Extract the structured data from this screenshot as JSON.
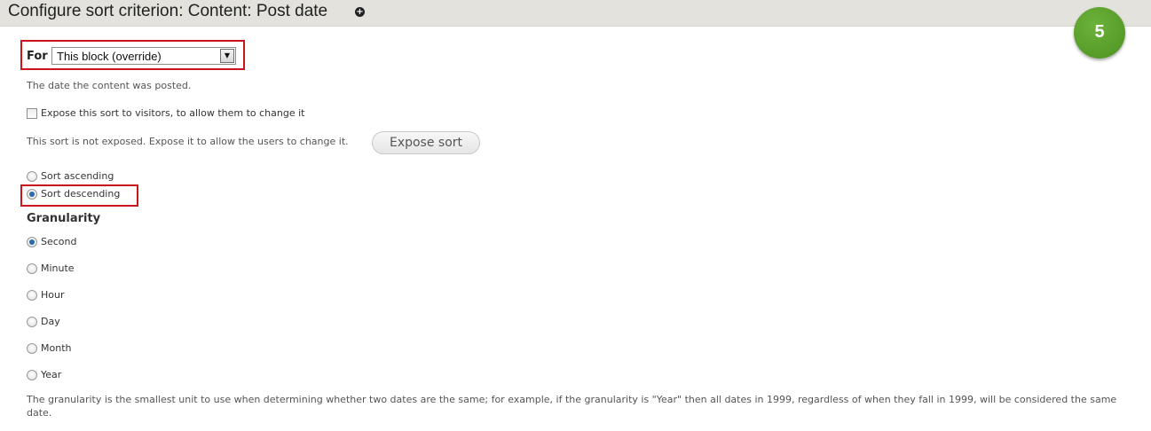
{
  "header": {
    "title": "Configure sort criterion: Content: Post date",
    "info_icon": "plus-circle-icon",
    "step_badge": "5"
  },
  "for_field": {
    "label": "For",
    "value": "This block (override)"
  },
  "field_description": "The date the content was posted.",
  "expose": {
    "checkbox_label": "Expose this sort to visitors, to allow them to change it",
    "checked": false,
    "status_text": "This sort is not exposed. Expose it to allow the users to change it.",
    "button_label": "Expose sort"
  },
  "order": {
    "options": [
      "Sort ascending",
      "Sort descending"
    ],
    "selected": "Sort descending"
  },
  "granularity": {
    "heading": "Granularity",
    "options": [
      "Second",
      "Minute",
      "Hour",
      "Day",
      "Month",
      "Year"
    ],
    "selected": "Second",
    "description": "The granularity is the smallest unit to use when determining whether two dates are the same; for example, if the granularity is \"Year\" then all dates in 1999, regardless of when they fall in 1999, will be considered the same date."
  },
  "colors": {
    "header_bg": "#e3e2dd",
    "highlight": "#c9161d",
    "badge": "#5ba12b",
    "radio_selected": "#2a6ba8"
  }
}
